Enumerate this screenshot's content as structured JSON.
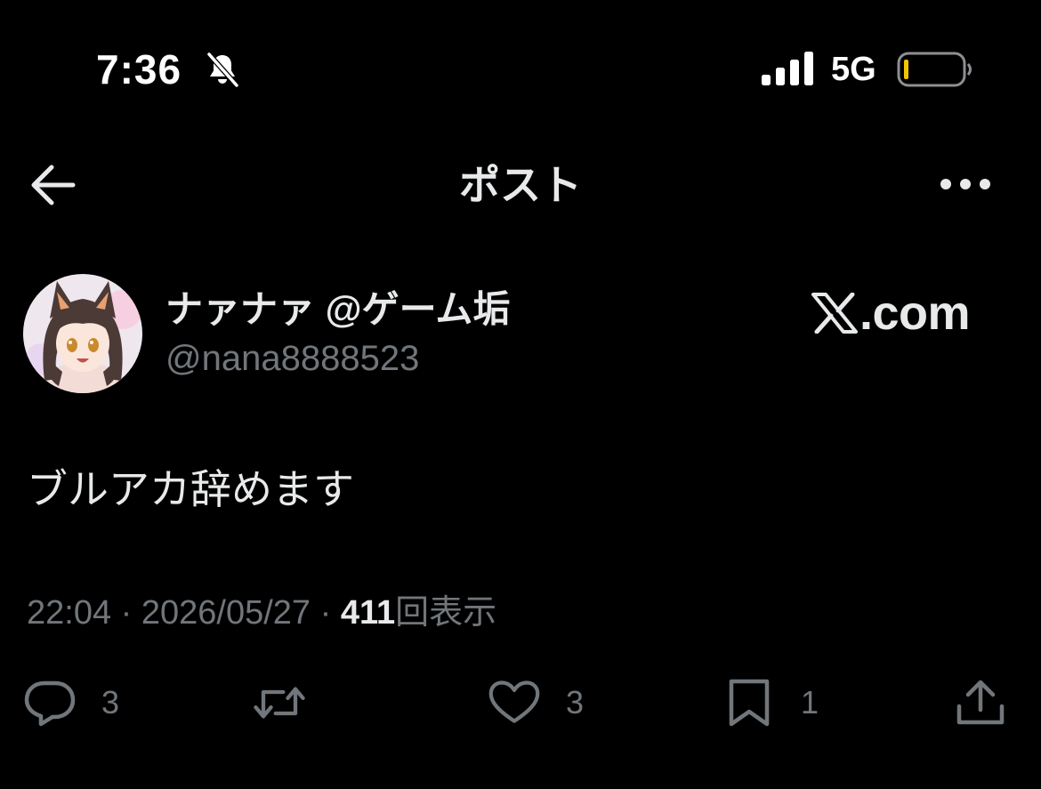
{
  "status_bar": {
    "time": "7:36",
    "network": "5G",
    "icons": [
      "bell-slash-icon",
      "signal-icon",
      "battery-icon"
    ]
  },
  "nav": {
    "title": "ポスト",
    "icons": [
      "back-arrow-icon",
      "more-icon"
    ]
  },
  "author": {
    "display_name": "ナァナァ @ゲーム垢",
    "handle": "@nana8888523"
  },
  "watermark": {
    "text": ".com"
  },
  "post": {
    "text": "ブルアカ辞めます"
  },
  "meta": {
    "time": "22:04",
    "separator": " · ",
    "date": "2026/05/27",
    "views": "411",
    "views_label": "回表示"
  },
  "actions": {
    "reply_count": "3",
    "repost_count": "",
    "like_count": "3",
    "bookmark_count": "1"
  },
  "colors": {
    "background": "#000000",
    "text": "#e7e9ea",
    "muted": "#71767b"
  }
}
